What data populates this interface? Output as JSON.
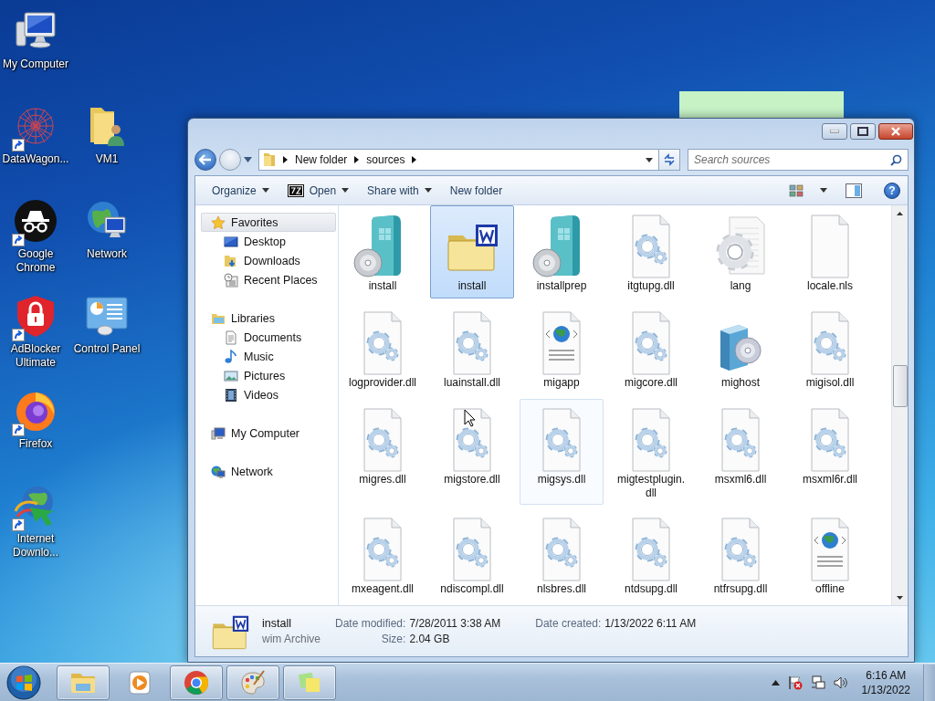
{
  "desktop": {
    "icon_rows": [
      [
        {
          "label": "My Computer",
          "kind": "computer",
          "shortcut": false
        }
      ],
      [
        {
          "label": "DataWagon...",
          "kind": "graph",
          "shortcut": true
        },
        {
          "label": "VM1",
          "kind": "user-folder",
          "shortcut": false
        }
      ],
      [
        {
          "label": "Google Chrome",
          "kind": "incognito",
          "shortcut": true
        },
        {
          "label": "Network",
          "kind": "network",
          "shortcut": false
        }
      ],
      [
        {
          "label": "AdBlocker Ultimate",
          "kind": "shield",
          "shortcut": true
        },
        {
          "label": "Control Panel",
          "kind": "control-panel",
          "shortcut": false
        }
      ],
      [
        {
          "label": "Firefox",
          "kind": "firefox",
          "shortcut": true
        }
      ],
      [
        {
          "label": "Internet Downlo...",
          "kind": "downloader",
          "shortcut": true
        }
      ]
    ]
  },
  "explorer": {
    "breadcrumb": [
      "New folder",
      "sources"
    ],
    "search": {
      "placeholder": "Search sources"
    },
    "toolbar": [
      {
        "label": "Organize",
        "kind": "menu"
      },
      {
        "label": "Open",
        "kind": "app"
      },
      {
        "label": "Share with",
        "kind": "menu"
      },
      {
        "label": "New folder",
        "kind": "plain"
      }
    ],
    "help": "?",
    "navigation": [
      {
        "label": "Favorites",
        "kind": "favorites",
        "selected": true,
        "children": [
          {
            "label": "Desktop",
            "kind": "desktop",
            "selected": false
          },
          {
            "label": "Downloads",
            "kind": "downloads",
            "selected": false
          },
          {
            "label": "Recent Places",
            "kind": "recent",
            "selected": false
          }
        ]
      },
      {
        "label": "Libraries",
        "kind": "libraries",
        "selected": false,
        "children": [
          {
            "label": "Documents",
            "kind": "documents",
            "selected": false
          },
          {
            "label": "Music",
            "kind": "music",
            "selected": false
          },
          {
            "label": "Pictures",
            "kind": "pictures",
            "selected": false
          },
          {
            "label": "Videos",
            "kind": "videos",
            "selected": false
          }
        ]
      },
      {
        "label": "My Computer",
        "kind": "computer",
        "selected": false
      },
      {
        "label": "Network",
        "kind": "network",
        "selected": false
      }
    ],
    "files": [
      {
        "name": "install",
        "kind": "setup",
        "selected": false,
        "hovered": false
      },
      {
        "name": "install",
        "kind": "archive",
        "selected": true,
        "hovered": false
      },
      {
        "name": "installprep",
        "kind": "setup",
        "selected": false,
        "hovered": false
      },
      {
        "name": "itgtupg.dll",
        "kind": "dll",
        "selected": false,
        "hovered": false
      },
      {
        "name": "lang",
        "kind": "gear",
        "selected": false,
        "hovered": false
      },
      {
        "name": "locale.nls",
        "kind": "blank",
        "selected": false,
        "hovered": false
      },
      {
        "name": "logprovider.dll",
        "kind": "dll",
        "selected": false,
        "hovered": false
      },
      {
        "name": "luainstall.dll",
        "kind": "dll",
        "selected": false,
        "hovered": false
      },
      {
        "name": "migapp",
        "kind": "web",
        "selected": false,
        "hovered": false
      },
      {
        "name": "migcore.dll",
        "kind": "dll",
        "selected": false,
        "hovered": false
      },
      {
        "name": "mighost",
        "kind": "package",
        "selected": false,
        "hovered": false
      },
      {
        "name": "migisol.dll",
        "kind": "dll",
        "selected": false,
        "hovered": false
      },
      {
        "name": "migres.dll",
        "kind": "dll",
        "selected": false,
        "hovered": false
      },
      {
        "name": "migstore.dll",
        "kind": "dll",
        "selected": false,
        "hovered": false
      },
      {
        "name": "migsys.dll",
        "kind": "dll",
        "selected": false,
        "hovered": true
      },
      {
        "name": "migtestplugin.dll",
        "kind": "dll",
        "selected": false,
        "hovered": false
      },
      {
        "name": "msxml6.dll",
        "kind": "dll",
        "selected": false,
        "hovered": false
      },
      {
        "name": "msxml6r.dll",
        "kind": "dll",
        "selected": false,
        "hovered": false
      },
      {
        "name": "mxeagent.dll",
        "kind": "dll",
        "selected": false,
        "hovered": false
      },
      {
        "name": "ndiscompl.dll",
        "kind": "dll",
        "selected": false,
        "hovered": false
      },
      {
        "name": "nlsbres.dll",
        "kind": "dll",
        "selected": false,
        "hovered": false
      },
      {
        "name": "ntdsupg.dll",
        "kind": "dll",
        "selected": false,
        "hovered": false
      },
      {
        "name": "ntfrsupg.dll",
        "kind": "dll",
        "selected": false,
        "hovered": false
      },
      {
        "name": "offline",
        "kind": "web",
        "selected": false,
        "hovered": false
      }
    ],
    "details": {
      "name": "install",
      "type": "wim Archive",
      "fields": [
        {
          "label": "Date modified:",
          "value": "7/28/2011 3:38 AM"
        },
        {
          "label": "Date created:",
          "value": "1/13/2022 6:11 AM"
        },
        {
          "label": "Size:",
          "value": "2.04 GB"
        }
      ]
    }
  },
  "taskbar": {
    "apps": [
      {
        "kind": "explorer",
        "open": true
      },
      {
        "kind": "media",
        "open": false
      },
      {
        "kind": "chrome",
        "open": true
      },
      {
        "kind": "paint",
        "open": true
      },
      {
        "kind": "notes",
        "open": true
      }
    ],
    "clock": {
      "time": "6:16 AM",
      "date": "1/13/2022"
    }
  }
}
